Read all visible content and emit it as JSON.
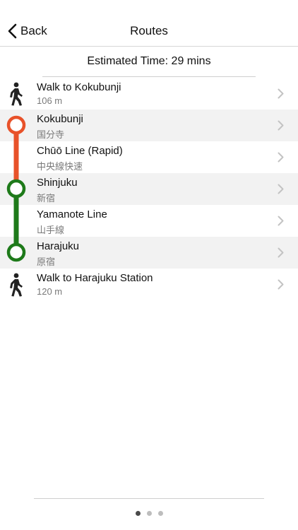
{
  "nav": {
    "back_label": "Back",
    "title": "Routes"
  },
  "summary": {
    "estimated_time": "Estimated Time: 29 mins"
  },
  "colors": {
    "chuo_line": "#E8522A",
    "yamanote_line": "#1E7A1A"
  },
  "route": [
    {
      "type": "walk",
      "icon": "walking-person-icon",
      "title": "Walk to Kokubunji",
      "subtitle": "106 m"
    },
    {
      "type": "station",
      "icon": "station-marker-icon",
      "title": "Kokubunji",
      "subtitle": "国分寺"
    },
    {
      "type": "line",
      "title": "Chūō Line (Rapid)",
      "subtitle": "中央線快速"
    },
    {
      "type": "station",
      "icon": "station-marker-icon",
      "title": "Shinjuku",
      "subtitle": "新宿"
    },
    {
      "type": "line",
      "title": "Yamanote Line",
      "subtitle": "山手線"
    },
    {
      "type": "station",
      "icon": "station-marker-icon",
      "title": "Harajuku",
      "subtitle": "原宿"
    },
    {
      "type": "walk",
      "icon": "walking-person-icon",
      "title": "Walk to Harajuku Station",
      "subtitle": "120 m"
    }
  ],
  "pagination": {
    "pages": 3,
    "current": 1
  }
}
